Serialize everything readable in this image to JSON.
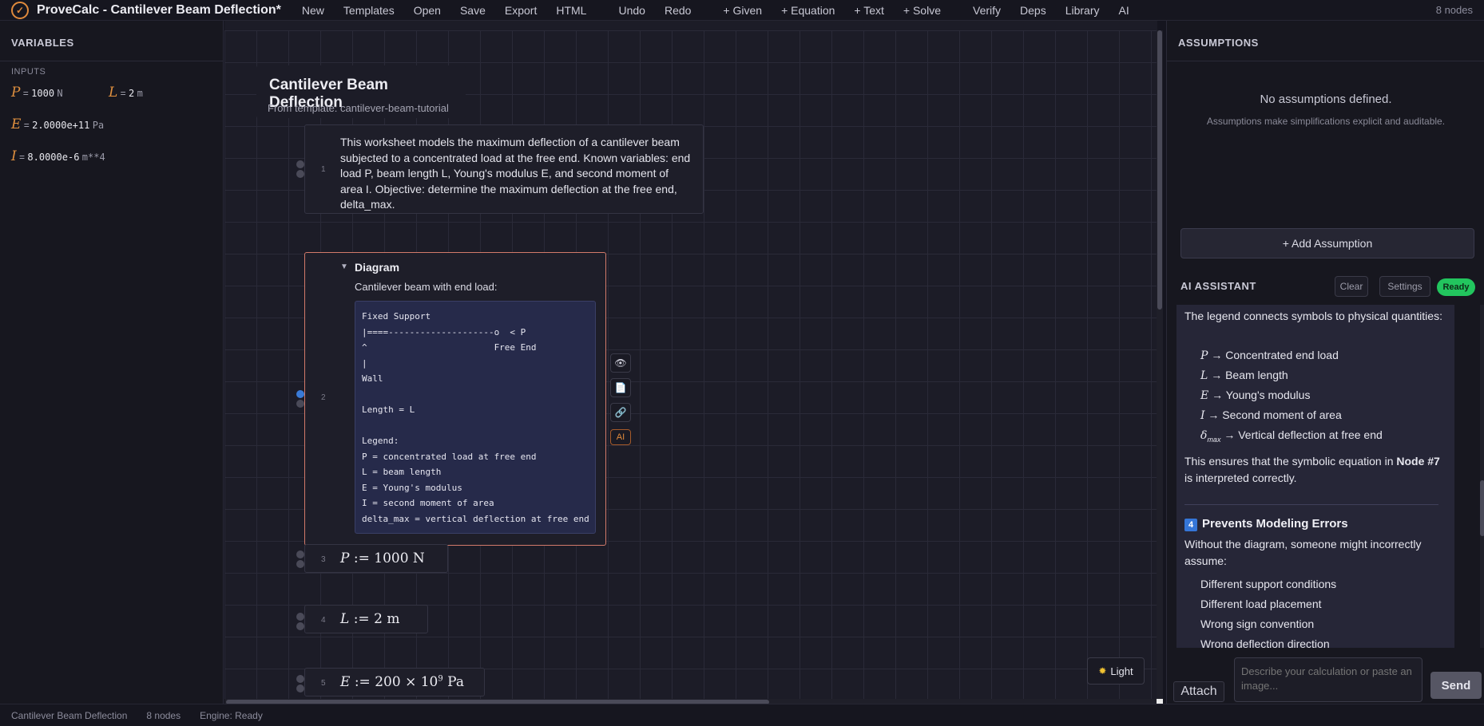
{
  "app": {
    "title": "ProveCalc - Cantilever Beam Deflection*",
    "node_count": "8 nodes"
  },
  "menu": {
    "new": "New",
    "templates": "Templates",
    "open": "Open",
    "save": "Save",
    "export": "Export",
    "html": "HTML",
    "undo": "Undo",
    "redo": "Redo",
    "given": "+ Given",
    "equation": "+ Equation",
    "text": "+ Text",
    "solve": "+ Solve",
    "verify": "Verify",
    "deps": "Deps",
    "library": "Library",
    "ai": "AI"
  },
  "variables": {
    "header": "VARIABLES",
    "inputs_label": "INPUTS",
    "items": [
      {
        "sym": "P",
        "value": "1000",
        "unit": "N"
      },
      {
        "sym": "L",
        "value": "2",
        "unit": "m"
      },
      {
        "sym": "E",
        "value": "2.0000e+11",
        "unit": "Pa"
      },
      {
        "sym": "I",
        "value": "8.0000e-6",
        "unit": "m**4"
      }
    ]
  },
  "worksheet": {
    "title": "Cantilever Beam Deflection",
    "subtitle": "From template: cantilever-beam-tutorial",
    "nodes": [
      {
        "num": "1",
        "text": "This worksheet models the maximum deflection of a cantilever beam subjected to a concentrated load at the free end. Known variables: end load P, beam length L, Young's modulus E, and second moment of area I. Objective: determine the maximum deflection at the free end, delta_max."
      },
      {
        "num": "2",
        "title": "Diagram",
        "caption": "Cantilever beam with end load:",
        "ascii": "Fixed Support\n|====--------------------o  < P\n^                        Free End\n|\nWall\n\nLength = L\n\nLegend:\nP = concentrated load at free end\nL = beam length\nE = Young's modulus\nI = second moment of area\ndelta_max = vertical deflection at free end"
      },
      {
        "num": "3",
        "sym": "P",
        "assign": ":=",
        "rhs": "1000 N"
      },
      {
        "num": "4",
        "sym": "L",
        "assign": ":=",
        "rhs": "2 m"
      },
      {
        "num": "5",
        "sym": "E",
        "assign": ":=",
        "rhs_pre": "200 × 10",
        "rhs_sup": "9",
        "rhs_post": " Pa"
      }
    ],
    "tools": {
      "view": "👁",
      "doc": "📄",
      "link": "🔗",
      "ai": "AI"
    },
    "theme_button": "Light",
    "theme_icon": "✹"
  },
  "assumptions": {
    "header": "ASSUMPTIONS",
    "empty": "No assumptions defined.",
    "help": "Assumptions make simplifications explicit and auditable.",
    "add_button": "+ Add Assumption"
  },
  "ai": {
    "header": "AI ASSISTANT",
    "clear": "Clear",
    "settings": "Settings",
    "status": "Ready",
    "status_color": "#22c55e",
    "intro": "The legend connects symbols to physical quantities:",
    "legend": [
      {
        "sym": "P",
        "sub": "",
        "text": "→ Concentrated end load"
      },
      {
        "sym": "L",
        "sub": "",
        "text": "→ Beam length"
      },
      {
        "sym": "E",
        "sub": "",
        "text": "→ Young's modulus"
      },
      {
        "sym": "I",
        "sub": "",
        "text": "→ Second moment of area"
      },
      {
        "sym": "δ",
        "sub": "max",
        "text": "→ Vertical deflection at free end"
      }
    ],
    "ensure_pre": "This ensures that the symbolic equation in ",
    "ensure_bold": "Node #7",
    "ensure_post": " is interpreted correctly.",
    "section_num": "4",
    "section_title": "Prevents Modeling Errors",
    "section_intro": "Without the diagram, someone might incorrectly assume:",
    "errors": [
      "Different support conditions",
      "Different load placement",
      "Wrong sign convention",
      "Wrong deflection direction"
    ],
    "attach": "Attach",
    "input_placeholder": "Describe your calculation or paste an image...",
    "send": "Send"
  },
  "status": {
    "doc": "Cantilever Beam Deflection",
    "nodes": "8 nodes",
    "engine": "Engine: Ready"
  }
}
